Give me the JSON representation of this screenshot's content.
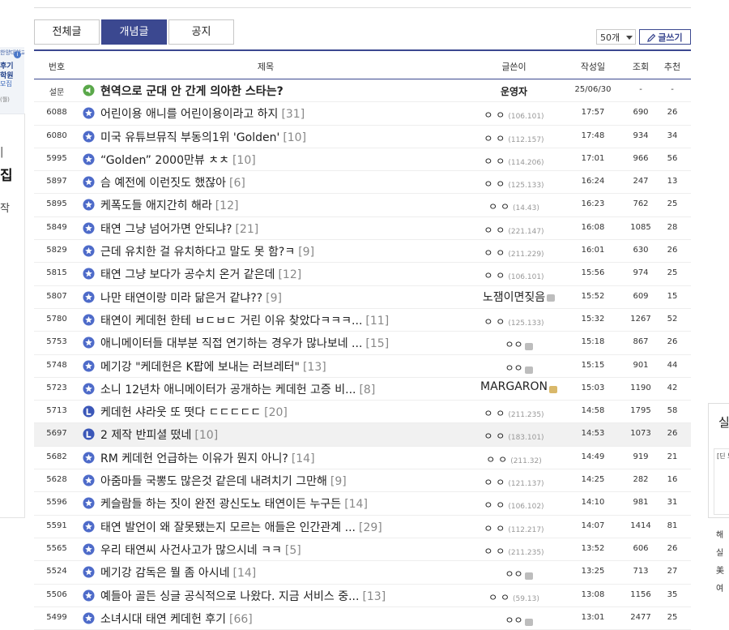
{
  "left_ad": {
    "line1": "한양대학교",
    "line2": "후기",
    "line3": "학원",
    "line4": "모집",
    "line5": "(월)",
    "badge": "i"
  },
  "left_box": {
    "c1": "|",
    "c2": "집",
    "c3": "작"
  },
  "tabs": [
    "전체글",
    "개념글",
    "공지"
  ],
  "active_tab": "개념글",
  "per_page": "50개",
  "write_button": "글쓰기",
  "columns": {
    "no": "번호",
    "title": "제목",
    "writer": "글쓴이",
    "date": "작성일",
    "views": "조회",
    "rec": "추천"
  },
  "accent_color": "#3b4890",
  "rows": [
    {
      "no": "설문",
      "icon": "survey",
      "title": "현역으로 군대 안 간게 의아한 스타는?",
      "count": "",
      "writer": "운영자",
      "ip": "",
      "date": "25/06/30",
      "views": "-",
      "rec": "-",
      "notice": true
    },
    {
      "no": "6088",
      "icon": "star",
      "title": "어린이용 애니를 어린이용이라고 하지",
      "count": "[31]",
      "writer": "ㅇ ㅇ",
      "ip": "(106.101)",
      "date": "17:57",
      "views": "690",
      "rec": "26"
    },
    {
      "no": "6080",
      "icon": "star",
      "title": "미국 유튜브뮤직 부동의1위 'Golden'",
      "count": "[10]",
      "writer": "ㅇ ㅇ",
      "ip": "(112.157)",
      "date": "17:48",
      "views": "934",
      "rec": "34"
    },
    {
      "no": "5995",
      "icon": "star",
      "title": "“Golden” 2000만뷰 ㅊㅊ",
      "count": "[10]",
      "writer": "ㅇ ㅇ",
      "ip": "(114.206)",
      "date": "17:01",
      "views": "966",
      "rec": "56"
    },
    {
      "no": "5897",
      "icon": "star",
      "title": "슴 예전에 이런짓도 했잖아",
      "count": "[6]",
      "writer": "ㅇ ㅇ",
      "ip": "(125.133)",
      "date": "16:24",
      "views": "247",
      "rec": "13"
    },
    {
      "no": "5895",
      "icon": "star",
      "title": "케폭도들 애지간히 해라",
      "count": "[12]",
      "writer": "ㅇ ㅇ",
      "ip": "(14.43)",
      "date": "16:23",
      "views": "762",
      "rec": "25"
    },
    {
      "no": "5849",
      "icon": "star",
      "title": "태연 그냥 넘어가면 안되냐?",
      "count": "[21]",
      "writer": "ㅇ ㅇ",
      "ip": "(221.147)",
      "date": "16:08",
      "views": "1085",
      "rec": "28"
    },
    {
      "no": "5829",
      "icon": "star",
      "title": "근데 유치한 걸 유치하다고 말도 못 함?ㅋ",
      "count": "[9]",
      "writer": "ㅇ ㅇ",
      "ip": "(211.229)",
      "date": "16:01",
      "views": "630",
      "rec": "26"
    },
    {
      "no": "5815",
      "icon": "star",
      "title": "태연 그냥 보다가 공수치 온거 같은데",
      "count": "[12]",
      "writer": "ㅇ ㅇ",
      "ip": "(106.101)",
      "date": "15:56",
      "views": "974",
      "rec": "25"
    },
    {
      "no": "5807",
      "icon": "star",
      "title": "나만 태연이랑 미라 닮은거 같냐??",
      "count": "[9]",
      "writer": "노잼이면짖음",
      "ip": "",
      "mark": "gray",
      "big": true,
      "date": "15:52",
      "views": "609",
      "rec": "15"
    },
    {
      "no": "5780",
      "icon": "star",
      "title": "태연이 케데헌 한테 ㅂㄷㅂㄷ 거린 이유 찾았다ㅋㅋㅋ...",
      "count": "[11]",
      "writer": "ㅇ ㅇ",
      "ip": "(125.133)",
      "date": "15:32",
      "views": "1267",
      "rec": "52"
    },
    {
      "no": "5753",
      "icon": "star",
      "title": "애니메이터들 대부분 직접 연기하는 경우가 많나보네 ...",
      "count": "[15]",
      "writer": "ㅇㅇ",
      "ip": "",
      "mark": "gray",
      "date": "15:18",
      "views": "867",
      "rec": "26"
    },
    {
      "no": "5748",
      "icon": "star",
      "title": "메기강 \"케데헌은 K팝에 보내는 러브레터\"",
      "count": "[13]",
      "writer": "ㅇㅇ",
      "ip": "",
      "mark": "gray",
      "date": "15:15",
      "views": "901",
      "rec": "44"
    },
    {
      "no": "5723",
      "icon": "star",
      "title": "소니 12년차 애니메이터가 공개하는 케데헌 고증 비...",
      "count": "[8]",
      "writer": "MARGARON",
      "ip": "",
      "mark": "gold",
      "big": true,
      "date": "15:03",
      "views": "1190",
      "rec": "42"
    },
    {
      "no": "5713",
      "icon": "L",
      "title": "케데헌 샤라웃 또 떳다 ㄷㄷㄷㄷㄷ",
      "count": "[20]",
      "writer": "ㅇ ㅇ",
      "ip": "(211.235)",
      "date": "14:58",
      "views": "1795",
      "rec": "58"
    },
    {
      "no": "5697",
      "icon": "L",
      "title": "2 제작 반피셜 떴네",
      "count": "[10]",
      "writer": "ㅇ ㅇ",
      "ip": "(183.101)",
      "date": "14:53",
      "views": "1073",
      "rec": "26",
      "highlight": true
    },
    {
      "no": "5682",
      "icon": "star",
      "title": "RM 케데헌 언급하는 이유가 뭔지 아니?",
      "count": "[14]",
      "writer": "ㅇ ㅇ",
      "ip": "(211.32)",
      "date": "14:49",
      "views": "919",
      "rec": "21"
    },
    {
      "no": "5628",
      "icon": "star",
      "title": "아줌마들 국뽕도 많은것 같은데 내려치기 그만해",
      "count": "[9]",
      "writer": "ㅇ ㅇ",
      "ip": "(121.137)",
      "date": "14:25",
      "views": "282",
      "rec": "16"
    },
    {
      "no": "5596",
      "icon": "star",
      "title": "케슬람들 하는 짓이 완전 광신도노 태연이든 누구든",
      "count": "[14]",
      "writer": "ㅇ ㅇ",
      "ip": "(106.102)",
      "date": "14:10",
      "views": "981",
      "rec": "31"
    },
    {
      "no": "5591",
      "icon": "star",
      "title": "태연 발언이 왜 잘못됐는지 모르는 애들은 인간관계 ...",
      "count": "[29]",
      "writer": "ㅇ ㅇ",
      "ip": "(112.217)",
      "date": "14:07",
      "views": "1414",
      "rec": "81"
    },
    {
      "no": "5565",
      "icon": "star",
      "title": "우리 태연씨 사건사고가 많으시네 ㅋㅋ",
      "count": "[5]",
      "writer": "ㅇ ㅇ",
      "ip": "(211.235)",
      "date": "13:52",
      "views": "606",
      "rec": "26"
    },
    {
      "no": "5524",
      "icon": "star",
      "title": "메기강 감독은 뭘 좀 아시네",
      "count": "[14]",
      "writer": "ㅇㅇ",
      "ip": "",
      "mark": "gray",
      "date": "13:25",
      "views": "713",
      "rec": "27"
    },
    {
      "no": "5506",
      "icon": "star",
      "title": "예들아 골든 싱글 공식적으로 나왔다. 지금 서비스 중...",
      "count": "[13]",
      "writer": "ㅇ ㅇ",
      "ip": "(59.13)",
      "date": "13:08",
      "views": "1156",
      "rec": "35"
    },
    {
      "no": "5499",
      "icon": "star",
      "title": "소녀시대 태연 케데헌 후기",
      "count": "[66]",
      "writer": "ㅇㅇ",
      "ip": "",
      "mark": "gray",
      "date": "13:01",
      "views": "2477",
      "rec": "25"
    }
  ],
  "right_box": {
    "title": "실",
    "card": "[딘 보 다",
    "lines": [
      "해",
      "실",
      "美",
      "여"
    ]
  }
}
